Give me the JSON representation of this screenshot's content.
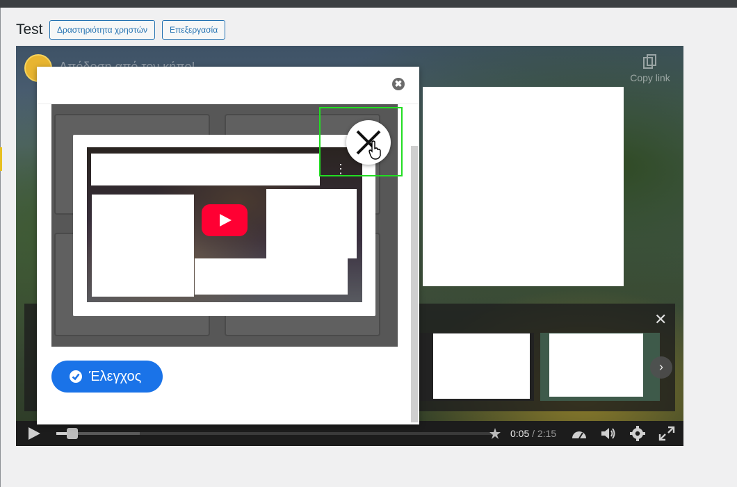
{
  "header": {
    "title": "Test",
    "buttons": [
      {
        "label": "Δραστηριότητα χρηστών"
      },
      {
        "label": "Επεξεργασία"
      }
    ]
  },
  "player": {
    "video_title": "Απόδοση από τον κήπο!",
    "copy_link_label": "Copy link",
    "time_current": "0:05",
    "time_separator": " / ",
    "time_total": "2:15",
    "progress_fraction": 0.037,
    "end_screen_close": "✕",
    "end_next": "›"
  },
  "modal": {
    "close_glyph": "✖",
    "video_menu": "⋮",
    "check_button_label": "Έλεγχος"
  },
  "colors": {
    "primary_button": "#1a73e8",
    "header_button_border": "#2271b1",
    "youtube_red": "#ff0033",
    "highlight": "#22dd22"
  }
}
